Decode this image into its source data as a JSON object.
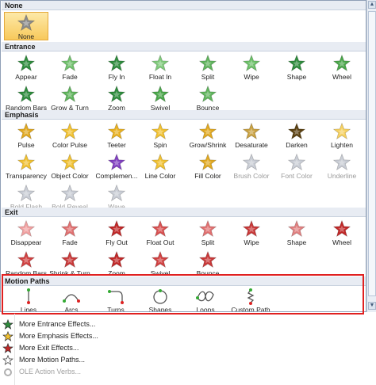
{
  "sections": [
    {
      "id": "none",
      "title": "None",
      "items": [
        {
          "label": "None",
          "selected": true,
          "color": "#8a8a8a",
          "shape": "star"
        }
      ]
    },
    {
      "id": "entrance",
      "title": "Entrance",
      "items": [
        {
          "label": "Appear",
          "color": "#2e8b3c",
          "shape": "star"
        },
        {
          "label": "Fade",
          "color": "#6fbf6b",
          "shape": "star"
        },
        {
          "label": "Fly In",
          "color": "#2e8b3c",
          "shape": "star"
        },
        {
          "label": "Float In",
          "color": "#7fc97a",
          "shape": "star"
        },
        {
          "label": "Split",
          "color": "#5fb35c",
          "shape": "star"
        },
        {
          "label": "Wipe",
          "color": "#6bbf67",
          "shape": "star"
        },
        {
          "label": "Shape",
          "color": "#2e8b3c",
          "shape": "star"
        },
        {
          "label": "Wheel",
          "color": "#4aa64a",
          "shape": "star"
        },
        {
          "label": "Random Bars",
          "color": "#2e8b3c",
          "shape": "star"
        },
        {
          "label": "Grow & Turn",
          "color": "#5fb35c",
          "shape": "star"
        },
        {
          "label": "Zoom",
          "color": "#2e8b3c",
          "shape": "star"
        },
        {
          "label": "Swivel",
          "color": "#4aa64a",
          "shape": "star"
        },
        {
          "label": "Bounce",
          "color": "#5fb35c",
          "shape": "star"
        }
      ]
    },
    {
      "id": "emphasis",
      "title": "Emphasis",
      "items": [
        {
          "label": "Pulse",
          "color": "#e0a820",
          "shape": "star"
        },
        {
          "label": "Color Pulse",
          "color": "#f0c030",
          "shape": "star"
        },
        {
          "label": "Teeter",
          "color": "#e8b020",
          "shape": "star"
        },
        {
          "label": "Spin",
          "color": "#f0c030",
          "shape": "star"
        },
        {
          "label": "Grow/Shrink",
          "color": "#e0a820",
          "shape": "star"
        },
        {
          "label": "Desaturate",
          "color": "#c8a040",
          "shape": "star"
        },
        {
          "label": "Darken",
          "color": "#5a4010",
          "shape": "star"
        },
        {
          "label": "Lighten",
          "color": "#f5d060",
          "shape": "star"
        },
        {
          "label": "Transparency",
          "color": "#f0c030",
          "shape": "star"
        },
        {
          "label": "Object Color",
          "color": "#f0c030",
          "shape": "star"
        },
        {
          "label": "Complemen...",
          "color": "#8040c0",
          "shape": "star"
        },
        {
          "label": "Line Color",
          "color": "#f0c030",
          "shape": "star"
        },
        {
          "label": "Fill Color",
          "color": "#e0a820",
          "shape": "star"
        },
        {
          "label": "Brush Color",
          "color": "#c8ccd4",
          "shape": "star",
          "disabled": true
        },
        {
          "label": "Font Color",
          "color": "#c8ccd4",
          "shape": "star",
          "disabled": true
        },
        {
          "label": "Underline",
          "color": "#c8ccd4",
          "shape": "star",
          "disabled": true
        },
        {
          "label": "Bold Flash",
          "color": "#c8ccd4",
          "shape": "star",
          "disabled": true
        },
        {
          "label": "Bold Reveal",
          "color": "#c8ccd4",
          "shape": "star",
          "disabled": true
        },
        {
          "label": "Wave",
          "color": "#c8ccd4",
          "shape": "star",
          "disabled": true
        }
      ]
    },
    {
      "id": "exit",
      "title": "Exit",
      "items": [
        {
          "label": "Disappear",
          "color": "#f0a0a0",
          "shape": "star"
        },
        {
          "label": "Fade",
          "color": "#e07070",
          "shape": "star"
        },
        {
          "label": "Fly Out",
          "color": "#c02828",
          "shape": "star"
        },
        {
          "label": "Float Out",
          "color": "#d85050",
          "shape": "star"
        },
        {
          "label": "Split",
          "color": "#e07070",
          "shape": "star"
        },
        {
          "label": "Wipe",
          "color": "#c83838",
          "shape": "star"
        },
        {
          "label": "Shape",
          "color": "#e08080",
          "shape": "star"
        },
        {
          "label": "Wheel",
          "color": "#c02828",
          "shape": "star"
        },
        {
          "label": "Random Bars",
          "color": "#d04040",
          "shape": "star"
        },
        {
          "label": "Shrink & Turn",
          "color": "#c83838",
          "shape": "star"
        },
        {
          "label": "Zoom",
          "color": "#c02828",
          "shape": "star"
        },
        {
          "label": "Swivel",
          "color": "#d04040",
          "shape": "star"
        },
        {
          "label": "Bounce",
          "color": "#c83838",
          "shape": "star"
        }
      ]
    },
    {
      "id": "motion",
      "title": "Motion Paths",
      "items": [
        {
          "label": "Lines",
          "shape": "line"
        },
        {
          "label": "Arcs",
          "shape": "arc"
        },
        {
          "label": "Turns",
          "shape": "turn"
        },
        {
          "label": "Shapes",
          "shape": "circle"
        },
        {
          "label": "Loops",
          "shape": "loop"
        },
        {
          "label": "Custom Path",
          "shape": "custom"
        }
      ]
    }
  ],
  "menu": [
    {
      "label": "More Entrance Effects...",
      "icon": "entrance-star-icon",
      "color": "#2e8b3c"
    },
    {
      "label": "More Emphasis Effects...",
      "icon": "emphasis-star-icon",
      "color": "#f0c030"
    },
    {
      "label": "More Exit Effects...",
      "icon": "exit-star-icon",
      "color": "#c02828"
    },
    {
      "label": "More Motion Paths...",
      "icon": "motion-star-icon",
      "color": "#ffffff"
    },
    {
      "label": "OLE Action Verbs...",
      "icon": "ole-gear-icon",
      "color": "#b0b0b0",
      "disabled": true
    }
  ],
  "accent": {
    "highlight": "#e02020",
    "selected": "#f8c95b",
    "section_bg": "#e8ecf3"
  }
}
